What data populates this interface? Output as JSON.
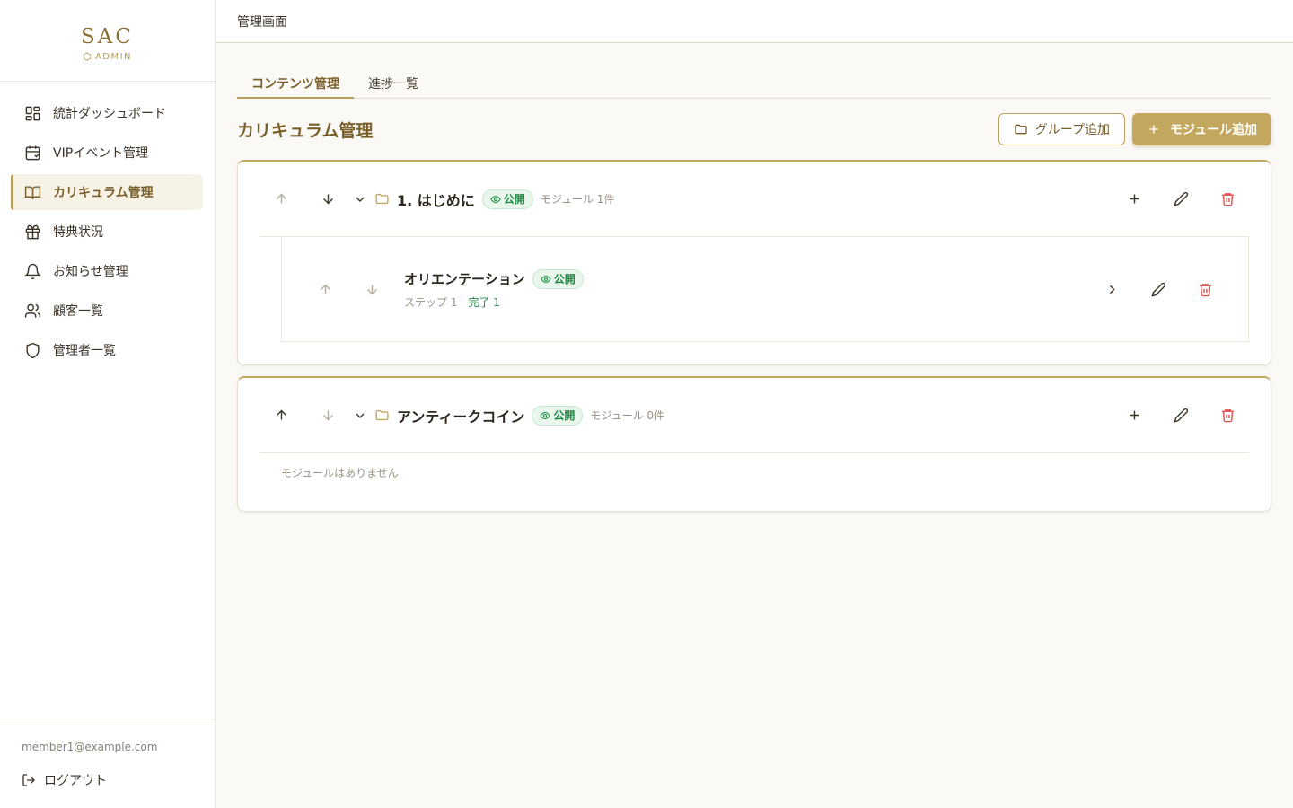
{
  "brand": {
    "title": "SAC",
    "subtitle": "ADMIN"
  },
  "sidebar": {
    "items": [
      {
        "label": "統計ダッシュボード",
        "icon": "dashboard-icon"
      },
      {
        "label": "VIPイベント管理",
        "icon": "calendar-icon"
      },
      {
        "label": "カリキュラム管理",
        "icon": "book-icon",
        "active": true
      },
      {
        "label": "特典状況",
        "icon": "gift-icon"
      },
      {
        "label": "お知らせ管理",
        "icon": "bell-icon"
      },
      {
        "label": "顧客一覧",
        "icon": "users-icon"
      },
      {
        "label": "管理者一覧",
        "icon": "shield-icon"
      }
    ],
    "user_email": "member1@example.com",
    "logout_label": "ログアウト"
  },
  "header": {
    "title": "管理画面"
  },
  "tabs": [
    {
      "label": "コンテンツ管理",
      "active": true
    },
    {
      "label": "進捗一覧",
      "active": false
    }
  ],
  "page": {
    "title": "カリキュラム管理",
    "add_group_label": "グループ追加",
    "add_module_label": "モジュール追加"
  },
  "groups": [
    {
      "name": "1. はじめに",
      "status": "公開",
      "module_count": "モジュール 1件",
      "modules": [
        {
          "name": "オリエンテーション",
          "status": "公開",
          "steps": "ステップ 1",
          "completed": "完了 1"
        }
      ]
    },
    {
      "name": "アンティークコイン",
      "status": "公開",
      "module_count": "モジュール 0件",
      "empty_text": "モジュールはありません"
    }
  ],
  "colors": {
    "accent": "#b79d5e",
    "accent_dark": "#7a5f2b",
    "primary_button": "#c3a75f",
    "public_badge": "#1f8a45",
    "delete": "#e05555"
  }
}
